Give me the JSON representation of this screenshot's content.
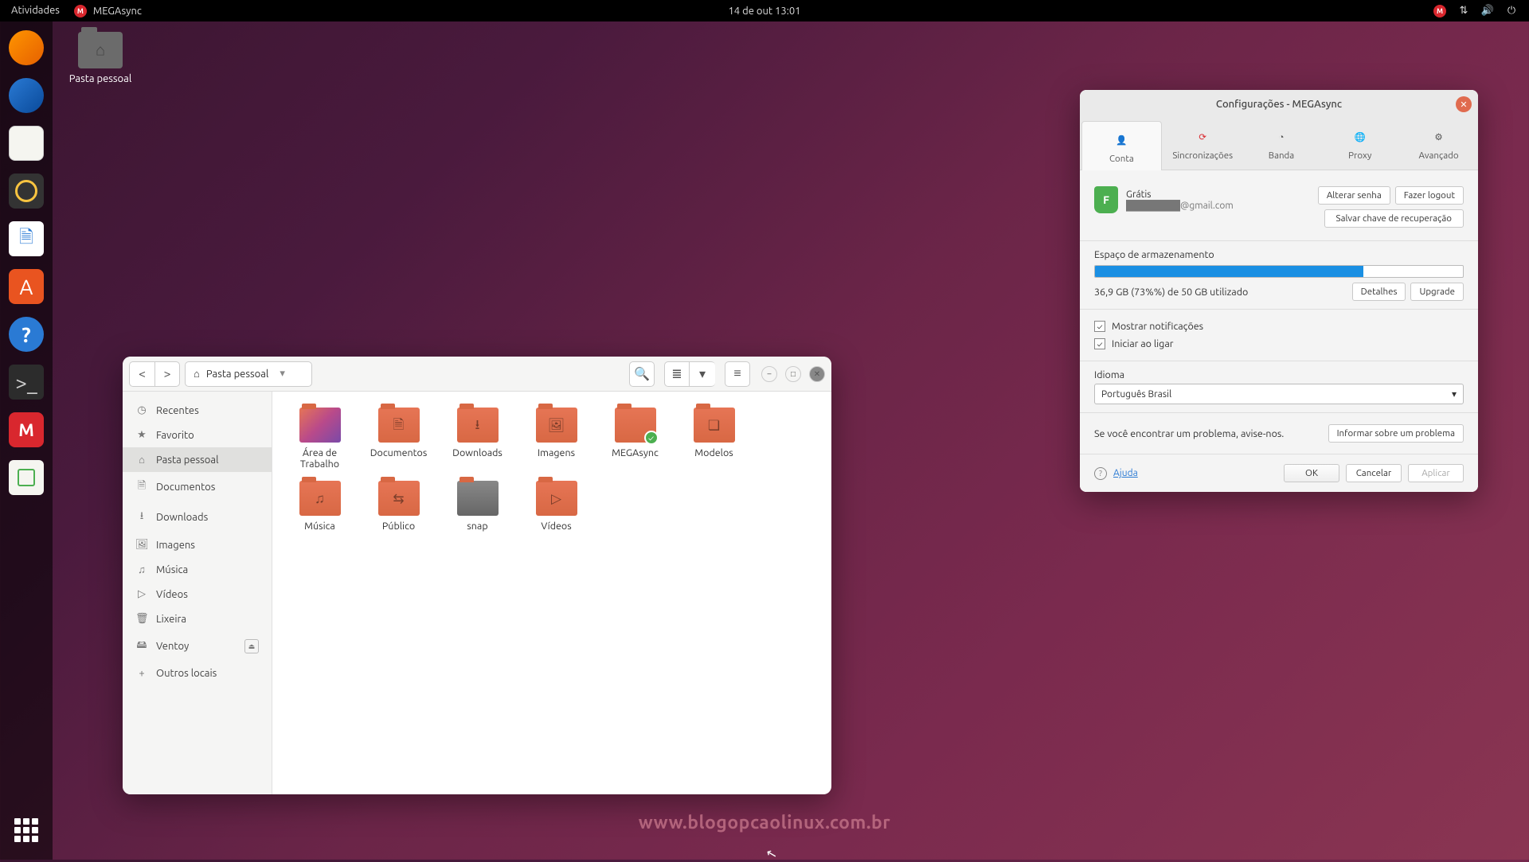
{
  "topbar": {
    "activities": "Atividades",
    "app_name": "MEGAsync",
    "datetime": "14 de out  13:01"
  },
  "desktop": {
    "home_label": "Pasta pessoal"
  },
  "nautilus": {
    "path_label": "Pasta pessoal",
    "sidebar": [
      {
        "icon": "◷",
        "label": "Recentes"
      },
      {
        "icon": "★",
        "label": "Favorito"
      },
      {
        "icon": "⌂",
        "label": "Pasta pessoal",
        "active": true
      },
      {
        "icon": "🗎",
        "label": "Documentos"
      },
      {
        "icon": "⭳",
        "label": "Downloads"
      },
      {
        "icon": "🖼",
        "label": "Imagens"
      },
      {
        "icon": "♫",
        "label": "Música"
      },
      {
        "icon": "▷",
        "label": "Vídeos"
      },
      {
        "icon": "🗑",
        "label": "Lixeira"
      },
      {
        "icon": "🖴",
        "label": "Ventoy",
        "eject": true
      },
      {
        "icon": "+",
        "label": "Outros locais"
      }
    ],
    "files": [
      {
        "label": "Área de Trabalho",
        "variant": "gradient",
        "emblem": ""
      },
      {
        "label": "Documentos",
        "variant": "",
        "emblem": "🗎"
      },
      {
        "label": "Downloads",
        "variant": "",
        "emblem": "⭳"
      },
      {
        "label": "Imagens",
        "variant": "",
        "emblem": "🖼"
      },
      {
        "label": "MEGAsync",
        "variant": "",
        "emblem": "",
        "badge": "✓"
      },
      {
        "label": "Modelos",
        "variant": "",
        "emblem": "❏"
      },
      {
        "label": "Música",
        "variant": "",
        "emblem": "♫"
      },
      {
        "label": "Público",
        "variant": "",
        "emblem": "⇆"
      },
      {
        "label": "snap",
        "variant": "snap",
        "emblem": ""
      },
      {
        "label": "Vídeos",
        "variant": "",
        "emblem": "▷"
      }
    ]
  },
  "mega": {
    "title": "Configurações - MEGAsync",
    "tabs": {
      "conta": "Conta",
      "sinc": "Sincronizações",
      "banda": "Banda",
      "proxy": "Proxy",
      "avancado": "Avançado"
    },
    "account": {
      "plan": "Grátis",
      "email": "████████@gmail.com",
      "btn_change_pw": "Alterar senha",
      "btn_logout": "Fazer logout",
      "btn_recovery": "Salvar chave de recuperação"
    },
    "storage": {
      "label": "Espaço de armazenamento",
      "usage_text": "36,9 GB (73%%) de 50 GB utilizado",
      "percent": 73,
      "btn_details": "Detalhes",
      "btn_upgrade": "Upgrade"
    },
    "opts": {
      "show_notif": "Mostrar notificações",
      "start_on_boot": "Iniciar ao ligar"
    },
    "lang": {
      "label": "Idioma",
      "value": "Português Brasil"
    },
    "issue": {
      "text": "Se você encontrar um problema, avise-nos.",
      "btn": "Informar sobre um problema"
    },
    "footer": {
      "help": "Ajuda",
      "ok": "OK",
      "cancel": "Cancelar",
      "apply": "Aplicar"
    }
  },
  "watermark": "www.blogopcaolinux.com.br"
}
